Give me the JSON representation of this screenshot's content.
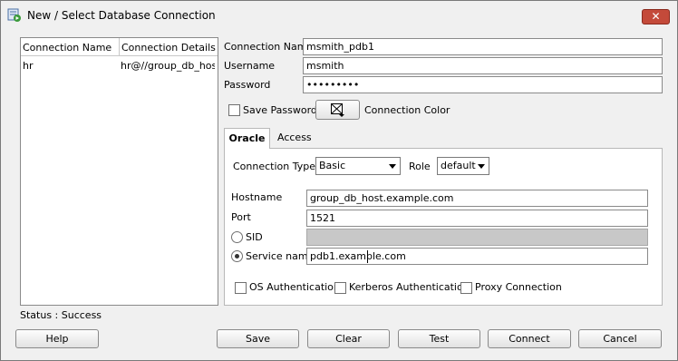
{
  "window": {
    "title": "New / Select Database Connection",
    "close_icon": "close-icon",
    "app_icon": "database-connection-icon"
  },
  "connection_list": {
    "columns": [
      "Connection Name",
      "Connection Details"
    ],
    "rows": [
      {
        "name": "hr",
        "details": "hr@//group_db_host..."
      }
    ]
  },
  "form": {
    "connection_name_label": "Connection Name",
    "connection_name_value": "msmith_pdb1",
    "username_label": "Username",
    "username_value": "msmith",
    "password_label": "Password",
    "password_value": "•••••••••",
    "save_password_label": "Save Password",
    "connection_color_label": "Connection Color"
  },
  "tabs": [
    {
      "label": "Oracle",
      "active": true
    },
    {
      "label": "Access",
      "active": false
    }
  ],
  "oracle": {
    "connection_type_label": "Connection Type",
    "connection_type_value": "Basic",
    "role_label": "Role",
    "role_value": "default",
    "hostname_label": "Hostname",
    "hostname_value": "group_db_host.example.com",
    "port_label": "Port",
    "port_value": "1521",
    "sid_label": "SID",
    "sid_value": "",
    "service_name_label": "Service name",
    "service_name_value": "pdb1.example.com",
    "os_auth_label": "OS Authentication",
    "kerberos_auth_label": "Kerberos Authentication",
    "proxy_label": "Proxy Connection"
  },
  "status": "Status : Success",
  "buttons": {
    "help": "Help",
    "save": "Save",
    "clear": "Clear",
    "test": "Test",
    "connect": "Connect",
    "cancel": "Cancel"
  }
}
